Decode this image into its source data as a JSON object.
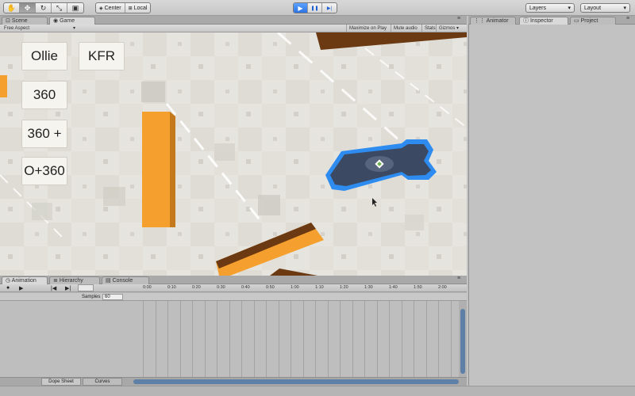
{
  "toolbar": {
    "tools": [
      {
        "icon": "hand-icon",
        "glyph": "✋"
      },
      {
        "icon": "move-icon",
        "glyph": "✥"
      },
      {
        "icon": "rotate-icon",
        "glyph": "↻"
      },
      {
        "icon": "scale-icon",
        "glyph": "⤡"
      },
      {
        "icon": "rect-icon",
        "glyph": "▣"
      }
    ],
    "pivot_label": "Center",
    "space_label": "Local",
    "playback": [
      {
        "icon": "play-icon",
        "glyph": "▶"
      },
      {
        "icon": "pause-icon",
        "glyph": "❚❚"
      },
      {
        "icon": "step-icon",
        "glyph": "▶|"
      }
    ],
    "layers_label": "Layers",
    "layout_label": "Layout",
    "dropdown_arrow": "▾"
  },
  "view_tabs": {
    "scene": "Scene",
    "game": "Game"
  },
  "game_bar": {
    "aspect": "Free Aspect",
    "maximize": "Maximize on Play",
    "mute": "Mute audio",
    "stats": "Stats",
    "gizmos": "Gizmos"
  },
  "game_buttons": {
    "ollie": "Ollie",
    "kfr": "KFR",
    "b360": "360",
    "b360plus": "360 +",
    "o360": "O+360"
  },
  "bottom_tabs": {
    "animation": "Animation",
    "hierarchy": "Hierarchy",
    "console": "Console"
  },
  "animation": {
    "samples_label": "Samples",
    "samples_value": "60",
    "ruler": [
      "0:00",
      "0:10",
      "0:20",
      "0:30",
      "0:40",
      "0:50",
      "1:00",
      "1:10",
      "1:20",
      "1:30",
      "1:40",
      "1:50",
      "2:00"
    ],
    "dope_sheet": "Dope Sheet",
    "curves": "Curves"
  },
  "right_tabs": {
    "animator": "Animator",
    "inspector": "Inspector",
    "project": "Project"
  },
  "colors": {
    "accent_blue": "#2c73e0",
    "orange": "#f5a02e",
    "orange_dark": "#6b3a12",
    "selection_outline": "#2e8cf0"
  }
}
